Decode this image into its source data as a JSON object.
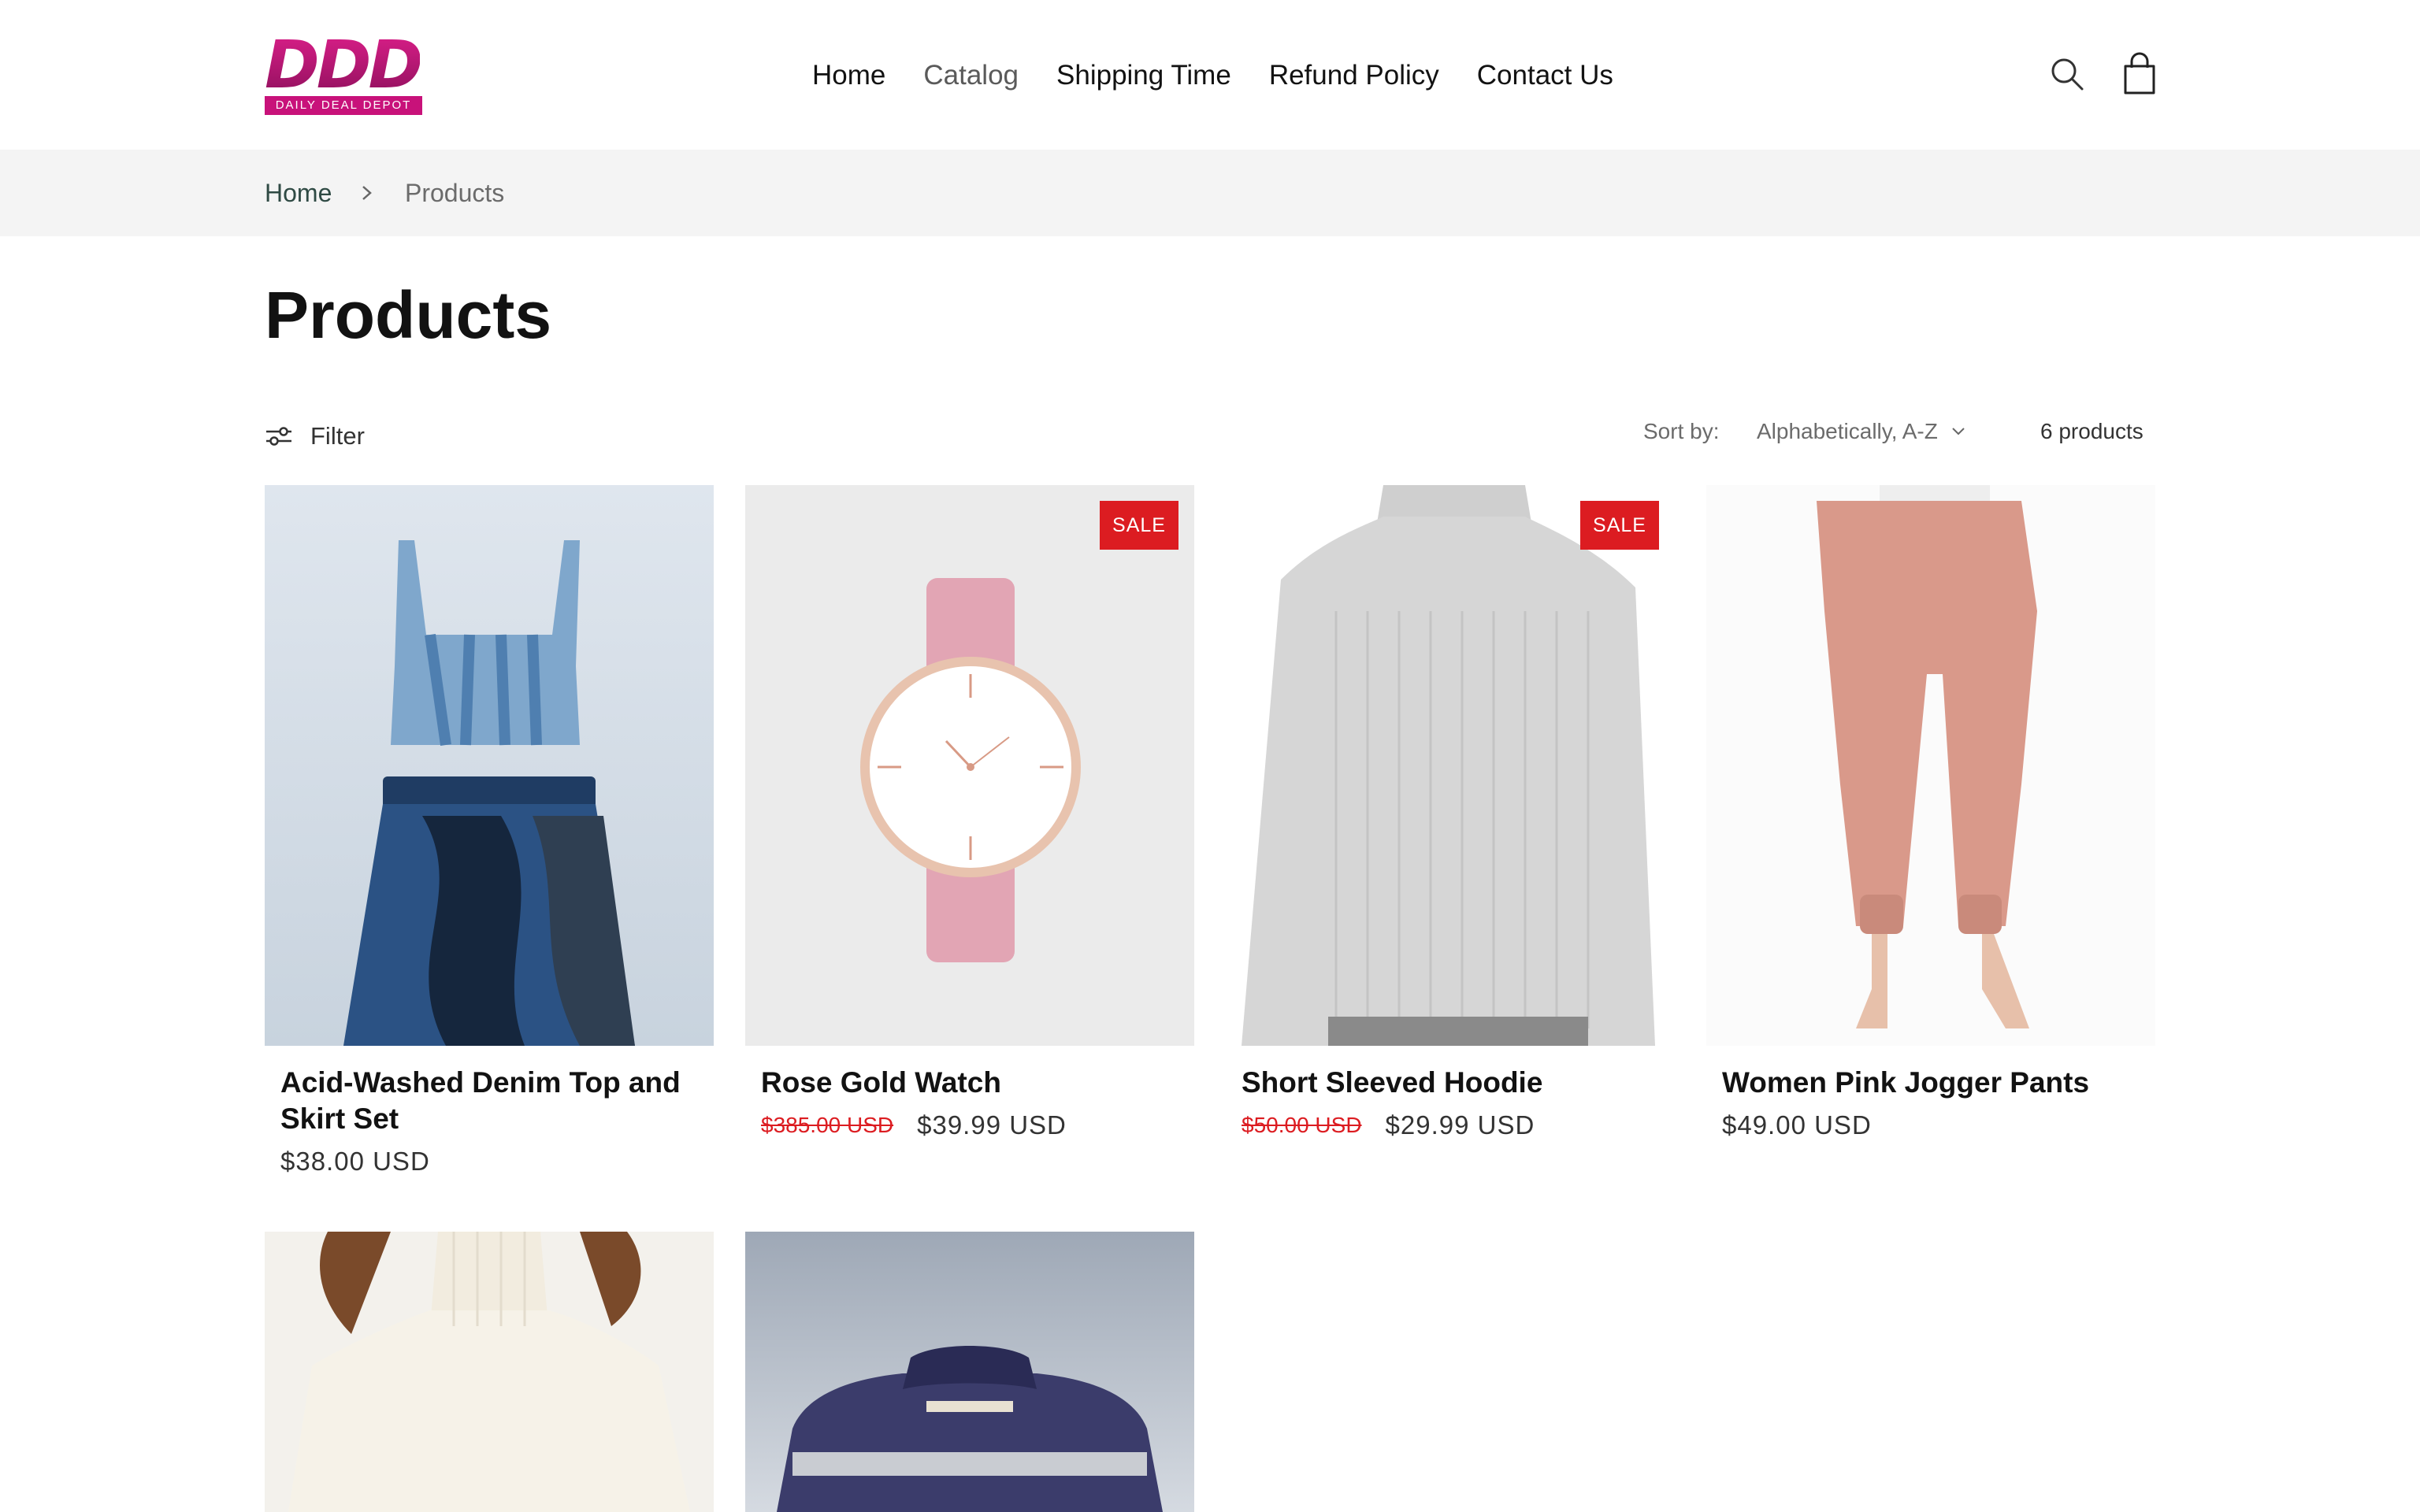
{
  "brand": {
    "logo_text": "DDD",
    "logo_subtitle": "DAILY DEAL DEPOT",
    "accent_color": "#c8127a"
  },
  "nav": {
    "items": [
      {
        "label": "Home",
        "active": false
      },
      {
        "label": "Catalog",
        "active": true
      },
      {
        "label": "Shipping Time",
        "active": false
      },
      {
        "label": "Refund Policy",
        "active": false
      },
      {
        "label": "Contact Us",
        "active": false
      }
    ],
    "icons": [
      "search-icon",
      "cart-icon"
    ]
  },
  "breadcrumb": {
    "home": "Home",
    "current": "Products"
  },
  "page": {
    "title": "Products"
  },
  "toolbar": {
    "filter_label": "Filter",
    "sort_label": "Sort by:",
    "sort_value": "Alphabetically, A-Z",
    "count": "6 products"
  },
  "products": [
    {
      "title": "Acid-Washed Denim Top and Skirt Set",
      "price": "$38.00 USD",
      "compare_price": "",
      "sale": false,
      "badge": ""
    },
    {
      "title": "Rose Gold Watch",
      "price": "$39.99 USD",
      "compare_price": "$385.00 USD",
      "sale": true,
      "badge": "SALE"
    },
    {
      "title": "Short Sleeved Hoodie",
      "price": "$29.99 USD",
      "compare_price": "$50.00 USD",
      "sale": true,
      "badge": "SALE"
    },
    {
      "title": "Women Pink Jogger Pants",
      "price": "$49.00 USD",
      "compare_price": "",
      "sale": false,
      "badge": ""
    },
    {
      "title": "",
      "price": "",
      "compare_price": "",
      "sale": false,
      "badge": ""
    },
    {
      "title": "",
      "price": "",
      "compare_price": "",
      "sale": false,
      "badge": ""
    }
  ],
  "colors": {
    "sale_badge": "#dc1c21",
    "breadcrumb_bg": "#f4f4f4",
    "text": "#121212"
  }
}
